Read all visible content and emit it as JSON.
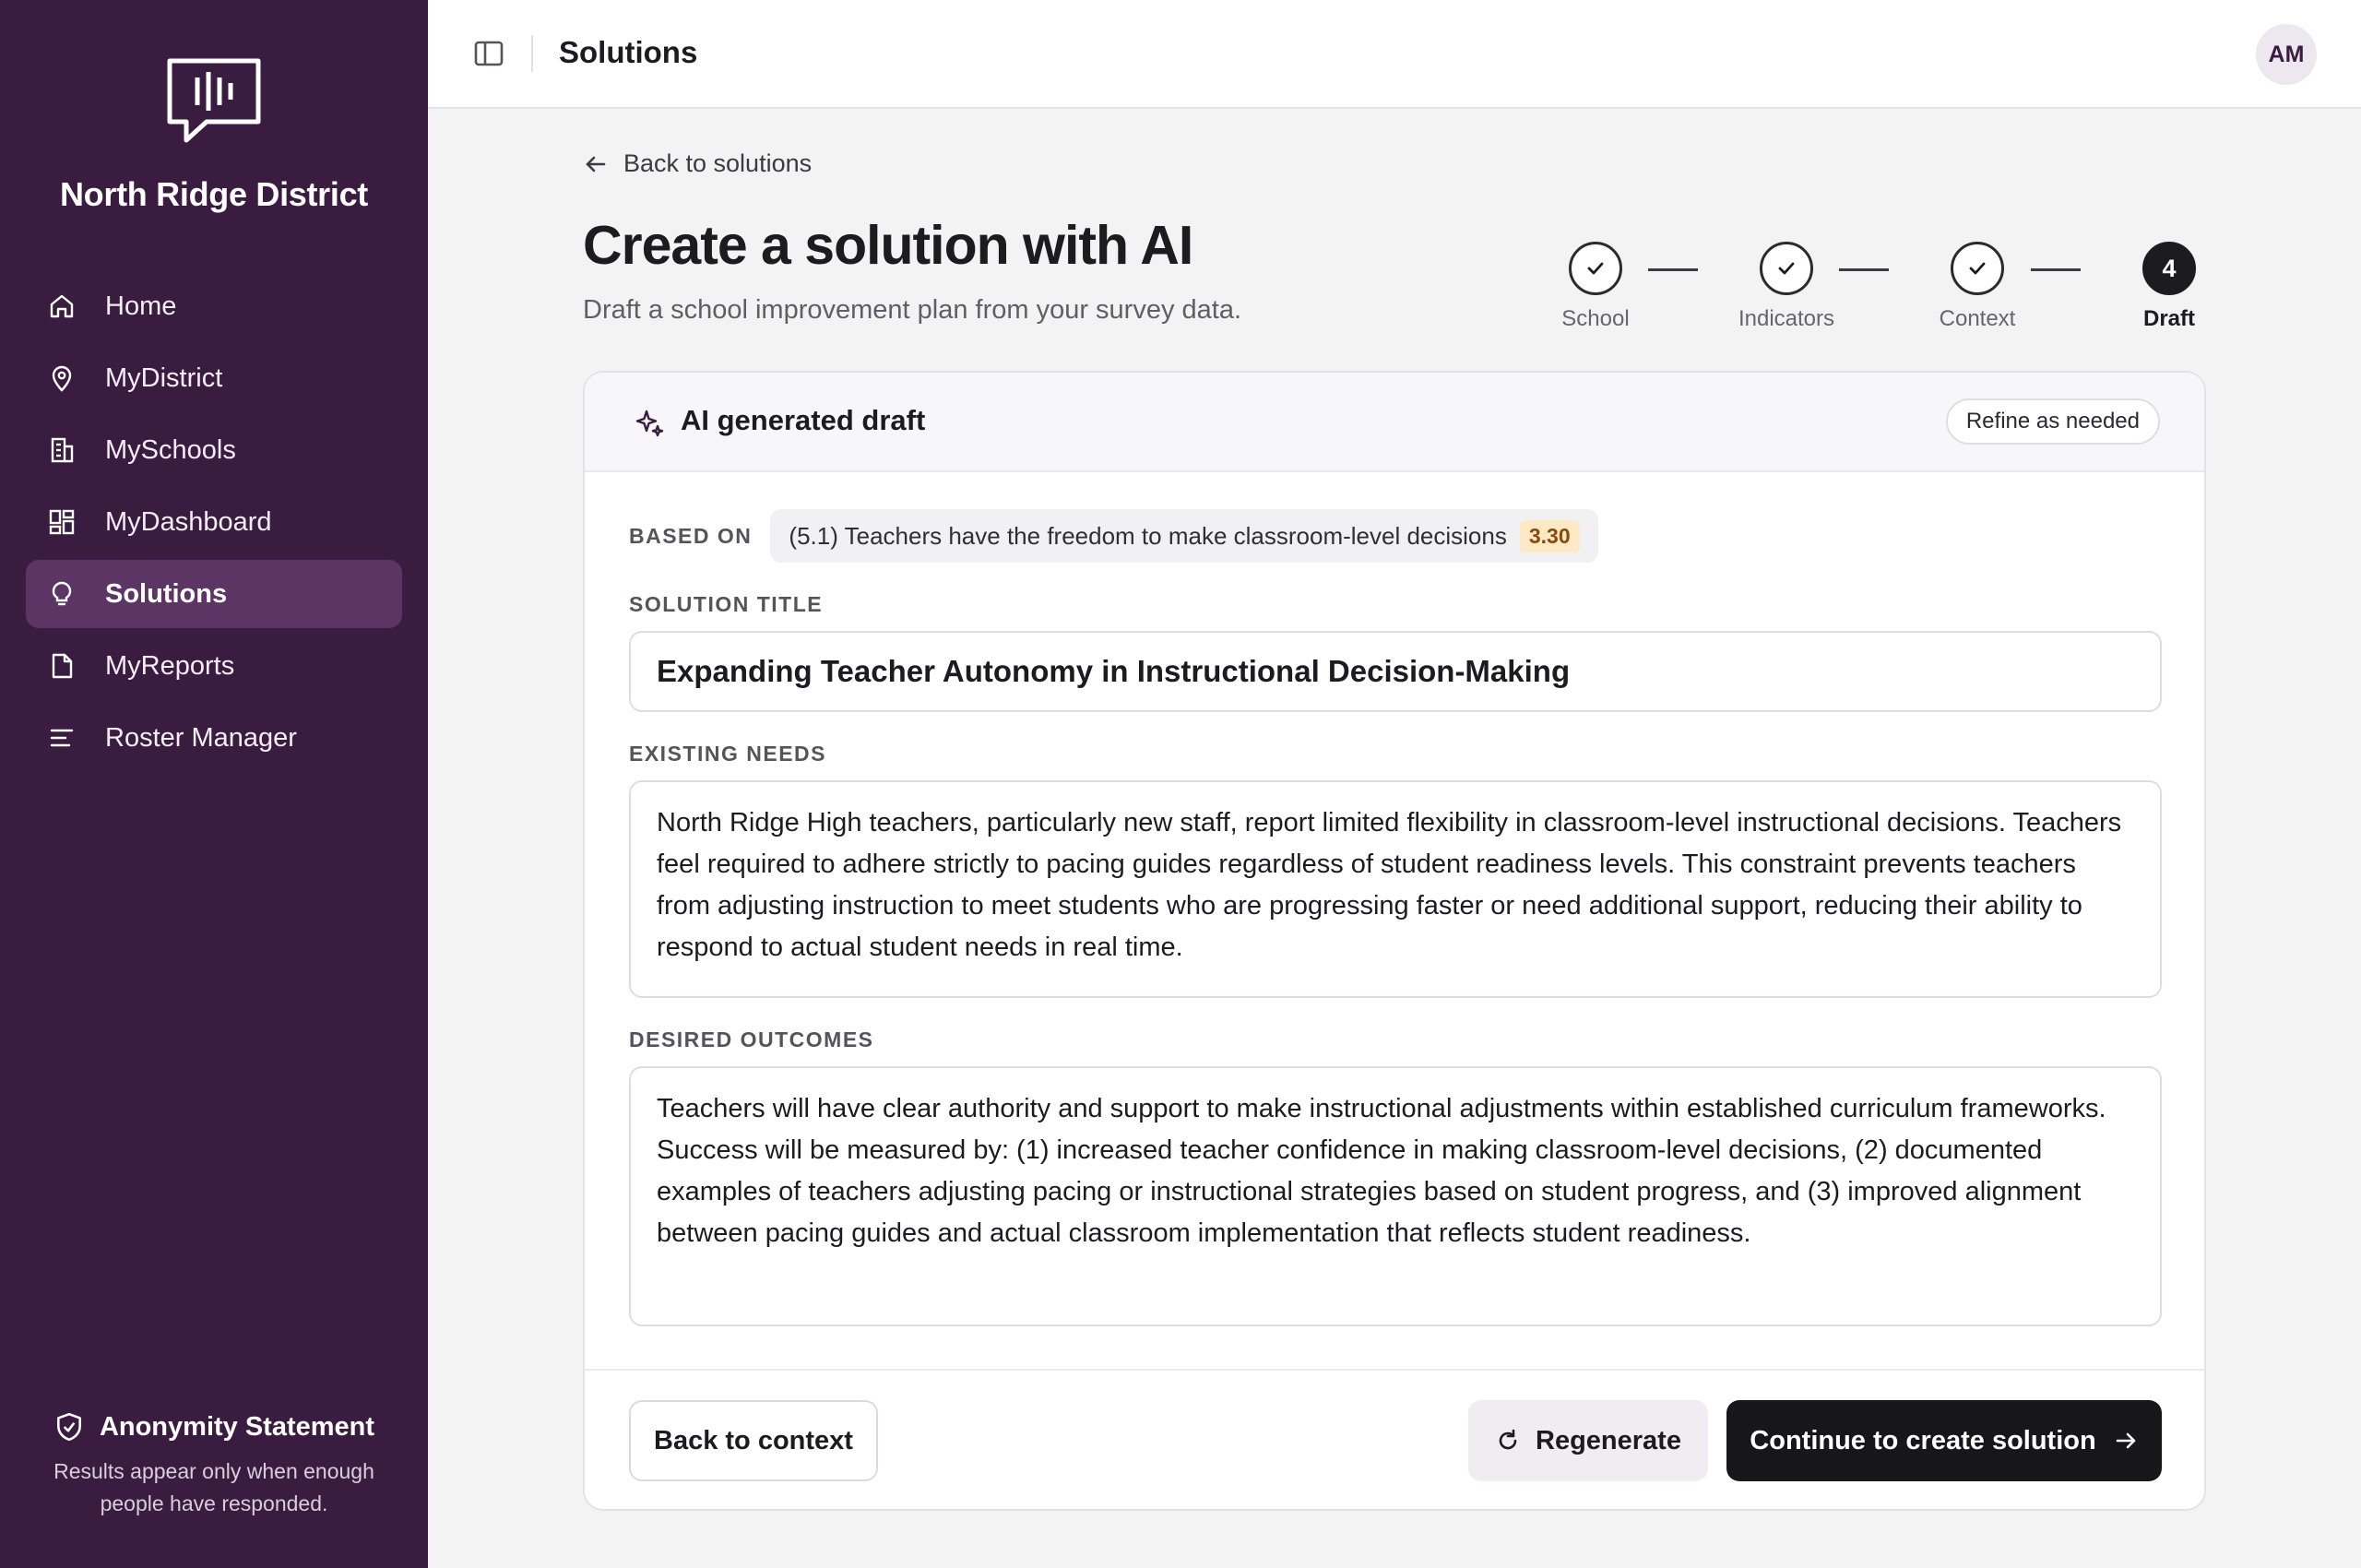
{
  "sidebar": {
    "org_name": "North Ridge District",
    "items": [
      {
        "label": "Home",
        "icon": "home-icon"
      },
      {
        "label": "MyDistrict",
        "icon": "map-pin-icon"
      },
      {
        "label": "MySchools",
        "icon": "building-icon"
      },
      {
        "label": "MyDashboard",
        "icon": "dashboard-icon"
      },
      {
        "label": "Solutions",
        "icon": "lightbulb-icon",
        "active": true
      },
      {
        "label": "MyReports",
        "icon": "file-icon"
      },
      {
        "label": "Roster Manager",
        "icon": "list-icon"
      }
    ],
    "anonymity": {
      "title": "Anonymity Statement",
      "text": "Results appear only when enough people have responded."
    }
  },
  "topbar": {
    "title": "Solutions",
    "avatar_initials": "AM"
  },
  "main": {
    "back_link": "Back to solutions",
    "title": "Create a solution with AI",
    "subtitle": "Draft a school improvement plan from your survey data.",
    "steps": [
      {
        "label": "School",
        "status": "complete"
      },
      {
        "label": "Indicators",
        "status": "complete"
      },
      {
        "label": "Context",
        "status": "complete"
      },
      {
        "label": "Draft",
        "number": "4",
        "status": "active"
      }
    ]
  },
  "card": {
    "header_title": "AI generated draft",
    "refine_label": "Refine as needed",
    "based_on_label": "BASED ON",
    "indicator_text": "(5.1) Teachers have the freedom to make classroom-level decisions",
    "indicator_score": "3.30",
    "solution_title_label": "SOLUTION TITLE",
    "solution_title": "Expanding Teacher Autonomy in Instructional Decision-Making",
    "existing_needs_label": "EXISTING NEEDS",
    "existing_needs": "North Ridge High teachers, particularly new staff, report limited flexibility in classroom-level instructional decisions. Teachers feel required to adhere strictly to pacing guides regardless of student readiness levels. This constraint prevents teachers from adjusting instruction to meet students who are progressing faster or need additional support, reducing their ability to respond to actual student needs in real time.",
    "desired_outcomes_label": "DESIRED OUTCOMES",
    "desired_outcomes": "Teachers will have clear authority and support to make instructional adjustments within established curriculum frameworks. Success will be measured by: (1) increased teacher confidence in making classroom-level decisions, (2) documented examples of teachers adjusting pacing or instructional strategies based on student progress, and (3) improved alignment between pacing guides and actual classroom implementation that reflects student readiness."
  },
  "footer": {
    "back_label": "Back to context",
    "regenerate_label": "Regenerate",
    "continue_label": "Continue to create solution"
  },
  "colors": {
    "sidebar_bg": "#3a1c40",
    "sidebar_active": "#5c3565",
    "primary_button": "#17161a",
    "score_badge_bg": "#fde9c5"
  }
}
